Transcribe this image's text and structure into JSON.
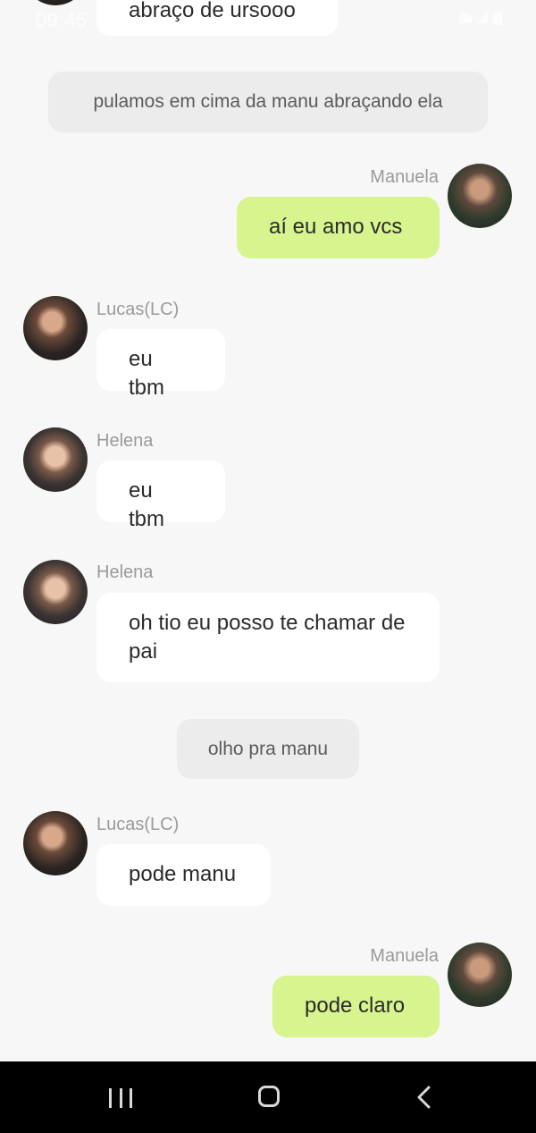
{
  "status_bar": {
    "time": "09:45"
  },
  "messages": [
    {
      "type": "bubble",
      "side": "left",
      "text": "abraço de ursooo"
    },
    {
      "type": "narration",
      "text": "pulamos em cima da manu abraçando ela"
    },
    {
      "type": "bubble",
      "side": "right",
      "sender": "Manuela",
      "text": "aí eu amo vcs"
    },
    {
      "type": "bubble",
      "side": "left",
      "sender": "Lucas(LC)",
      "text": "eu tbm"
    },
    {
      "type": "bubble",
      "side": "left",
      "sender": "Helena",
      "text": "eu tbm"
    },
    {
      "type": "bubble",
      "side": "left",
      "sender": "Helena",
      "text": "oh tio eu posso te chamar de pai"
    },
    {
      "type": "narration",
      "text": "olho pra manu"
    },
    {
      "type": "bubble",
      "side": "left",
      "sender": "Lucas(LC)",
      "text": "pode manu"
    },
    {
      "type": "bubble",
      "side": "right",
      "sender": "Manuela",
      "text": "pode claro"
    }
  ],
  "colors": {
    "background": "#f7f7f7",
    "own_bubble": "#d7f48f",
    "other_bubble": "#ffffff",
    "narration_bubble": "#ececec",
    "sender_name": "#9a9a9a",
    "nav_bar": "#000000"
  },
  "nav_bar": {
    "recents": "recent-apps-icon",
    "home": "home-icon",
    "back": "back-icon"
  }
}
